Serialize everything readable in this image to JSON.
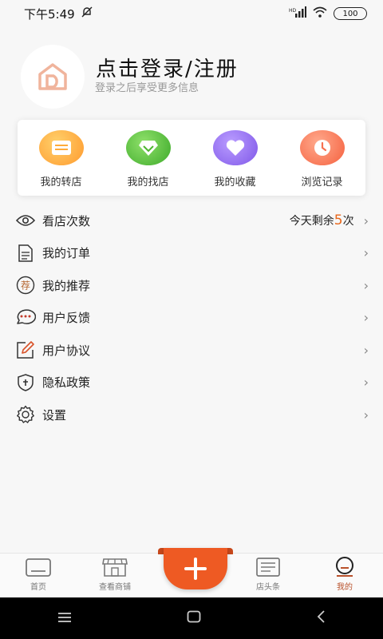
{
  "status": {
    "time": "下午5:49",
    "battery": "100",
    "signal_label": "HD"
  },
  "profile": {
    "title": "点击登录/注册",
    "subtitle": "登录之后享受更多信息"
  },
  "quick": [
    {
      "label": "我的转店",
      "icon": "card-icon",
      "color": "#ffb23e"
    },
    {
      "label": "我的找店",
      "icon": "diamond-icon",
      "color": "#5ac53a"
    },
    {
      "label": "我的收藏",
      "icon": "heart-icon",
      "color": "#9a72ef"
    },
    {
      "label": "浏览记录",
      "icon": "clock-icon",
      "color": "#ff7f5e"
    }
  ],
  "menu": [
    {
      "label": "看店次数",
      "icon": "eye-icon",
      "extra_prefix": "今天剩余",
      "extra_count": "5",
      "extra_suffix": "次"
    },
    {
      "label": "我的订单",
      "icon": "document-icon"
    },
    {
      "label": "我的推荐",
      "icon": "recommend-icon",
      "icon_text": "荐"
    },
    {
      "label": "用户反馈",
      "icon": "chat-icon"
    },
    {
      "label": "用户协议",
      "icon": "edit-icon"
    },
    {
      "label": "隐私政策",
      "icon": "shield-icon"
    },
    {
      "label": "设置",
      "icon": "gear-icon"
    }
  ],
  "chevron": "›",
  "tabs": [
    {
      "label": "首页",
      "icon": "home-icon"
    },
    {
      "label": "查看商铺",
      "icon": "store-icon"
    },
    {
      "label": "店头条",
      "icon": "news-icon"
    },
    {
      "label": "我的",
      "icon": "profile-icon",
      "active": true
    }
  ],
  "fab_symbol": "+",
  "colors": {
    "accent": "#ee5a23",
    "active_tab": "#b8502a"
  }
}
